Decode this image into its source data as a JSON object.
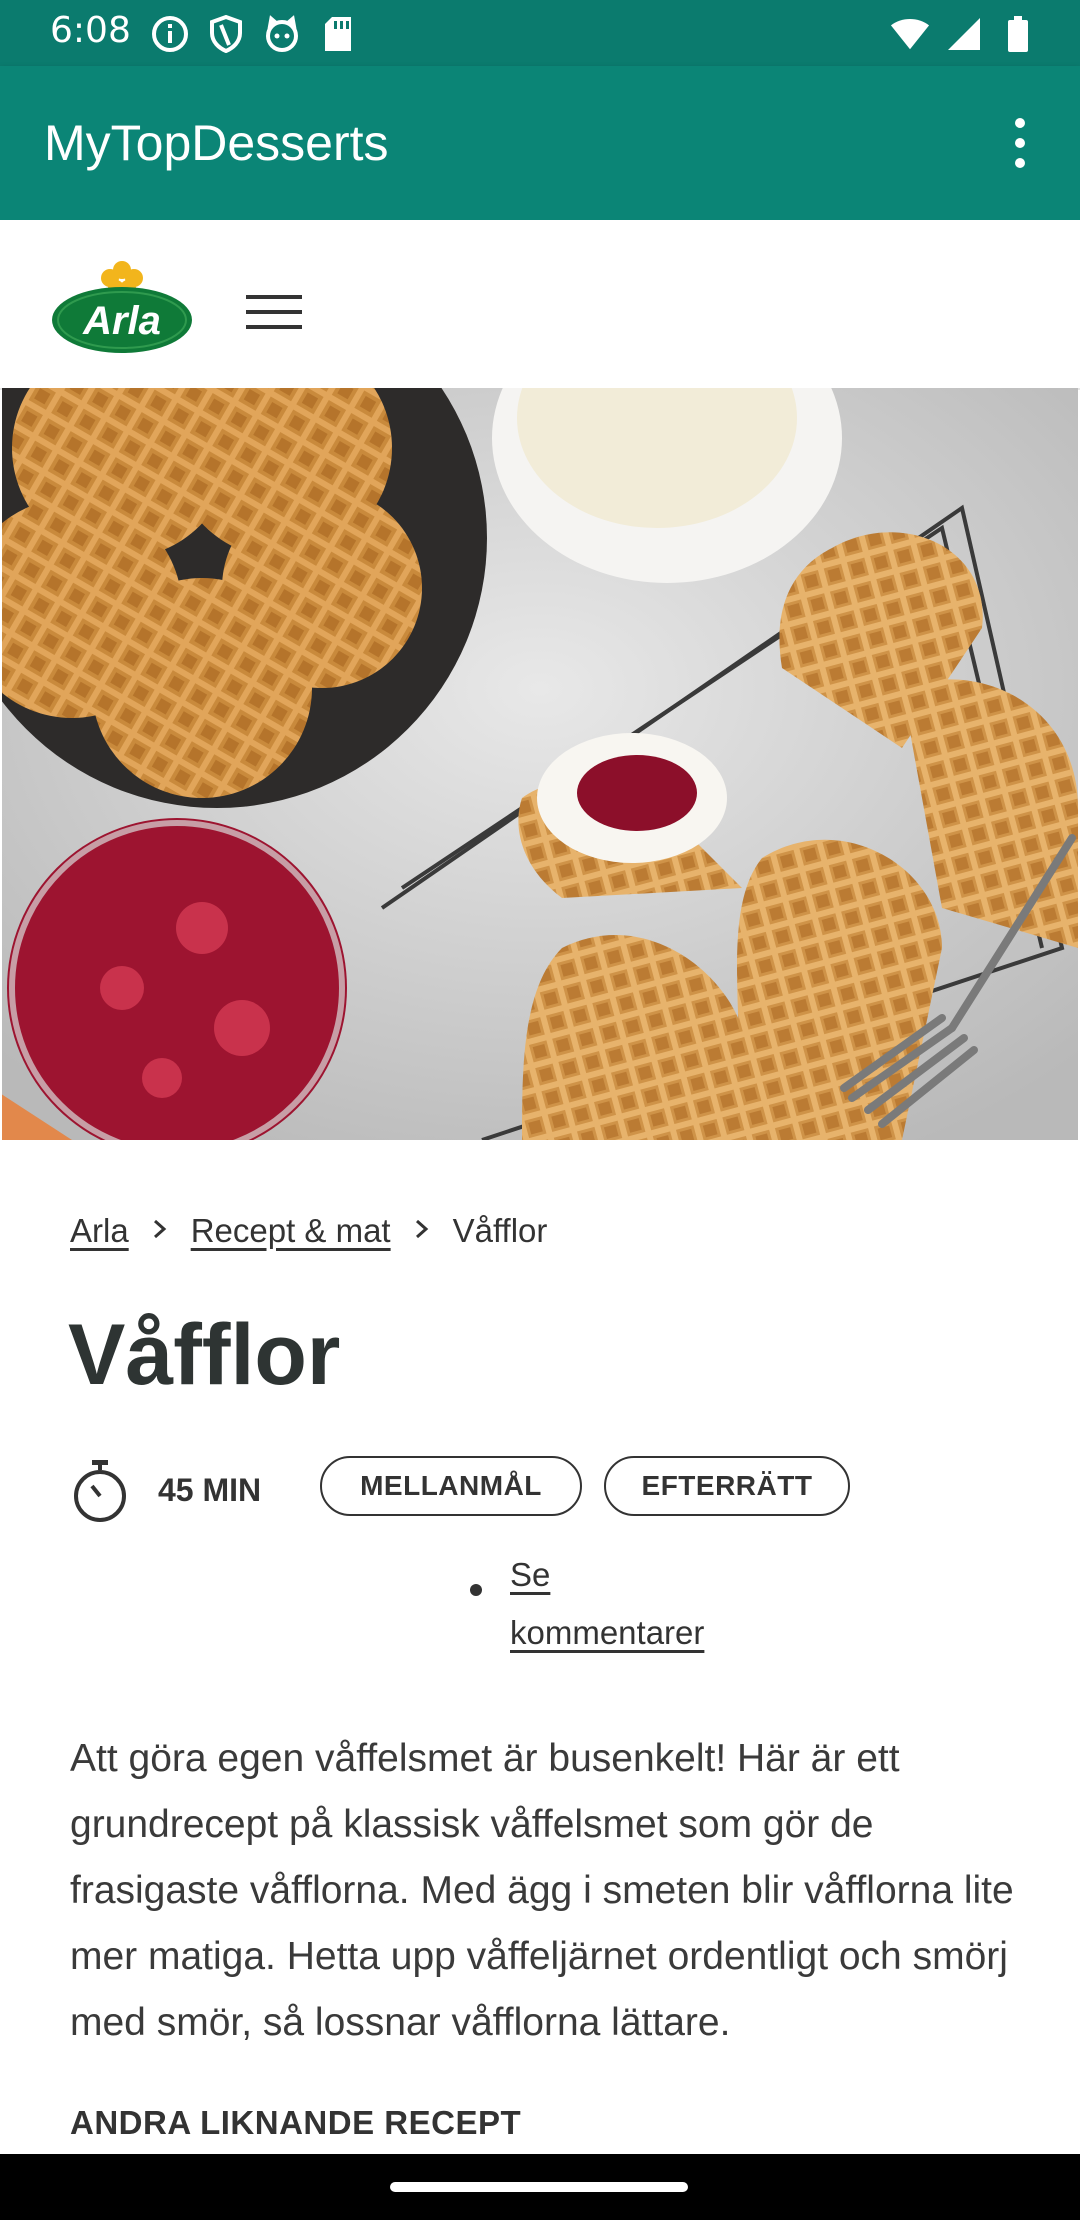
{
  "status_bar": {
    "time": "6:08",
    "left_icons": [
      "info-icon",
      "shield-icon",
      "cat-icon",
      "sd-card-icon"
    ],
    "right_icons": [
      "wifi-icon",
      "signal-icon",
      "battery-icon"
    ]
  },
  "app_bar": {
    "title": "MyTopDesserts",
    "menu_icon": "more-vert-icon",
    "color": "#0b8576"
  },
  "web_header": {
    "logo_text": "Arla",
    "menu_icon": "hamburger-icon"
  },
  "hero": {
    "description_icon": "waffles-photo"
  },
  "breadcrumb": {
    "items": [
      "Arla",
      "Recept & mat",
      "Våfflor"
    ]
  },
  "recipe": {
    "title": "Våfflor",
    "time": "45 MIN",
    "tags": [
      "MELLANMÅL",
      "EFTERRÄTT"
    ],
    "comments_link_line1": "Se",
    "comments_link_line2": "kommentarer",
    "intro": "Att göra egen våffelsmet är busenkelt! Här är ett grundrecept på klassisk våffelsmet som gör de frasigaste våfflorna. Med ägg i smeten blir våfflorna lite mer matiga. Hetta upp våffeljärnet ordentligt och smörj med smör, så lossnar våfflorna lättare.",
    "similar_heading": "ANDRA LIKNANDE RECEPT"
  }
}
